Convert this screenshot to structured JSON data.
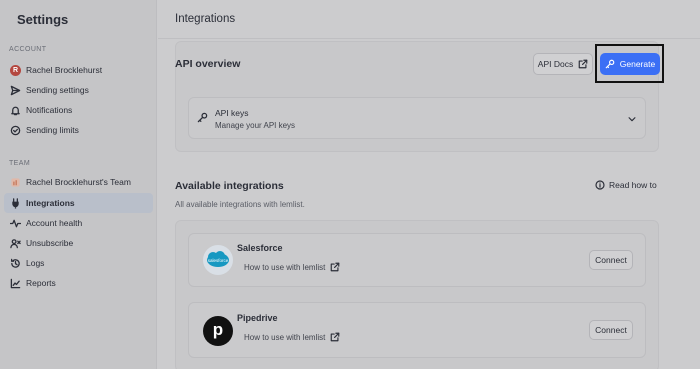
{
  "sidebar": {
    "title": "Settings",
    "account_section": "ACCOUNT",
    "account_items": [
      {
        "label": "Rachel Brocklehurst",
        "icon": "avatar-R"
      },
      {
        "label": "Sending settings",
        "icon": "send-icon"
      },
      {
        "label": "Notifications",
        "icon": "bell-icon"
      },
      {
        "label": "Sending limits",
        "icon": "check-circle-icon"
      }
    ],
    "avatar_letter": "R",
    "team_section": "TEAM",
    "team_items": [
      {
        "label": "Rachel Brocklehurst's Team",
        "icon": "team-icon"
      },
      {
        "label": "Integrations",
        "icon": "plug-icon",
        "active": true
      },
      {
        "label": "Account health",
        "icon": "pulse-icon"
      },
      {
        "label": "Unsubscribe",
        "icon": "user-x-icon"
      },
      {
        "label": "Logs",
        "icon": "history-icon"
      },
      {
        "label": "Reports",
        "icon": "chart-icon"
      }
    ]
  },
  "main": {
    "title": "Integrations",
    "api_overview": {
      "title": "API overview",
      "docs_label": "API Docs",
      "generate_label": "Generate",
      "keys_title": "API keys",
      "keys_subtitle": "Manage your API keys"
    },
    "available": {
      "title": "Available integrations",
      "subtitle": "All available integrations with lemlist.",
      "read_label": "Read how to",
      "items": [
        {
          "name": "Salesforce",
          "link": "How to use with lemlist",
          "action": "Connect",
          "logo_text": "salesforce"
        },
        {
          "name": "Pipedrive",
          "link": "How to use with lemlist",
          "action": "Connect",
          "logo_text": "p"
        }
      ]
    }
  },
  "colors": {
    "primary": "#3b6ff5",
    "salesforce": "#1798c1",
    "pipedrive": "#111111"
  }
}
